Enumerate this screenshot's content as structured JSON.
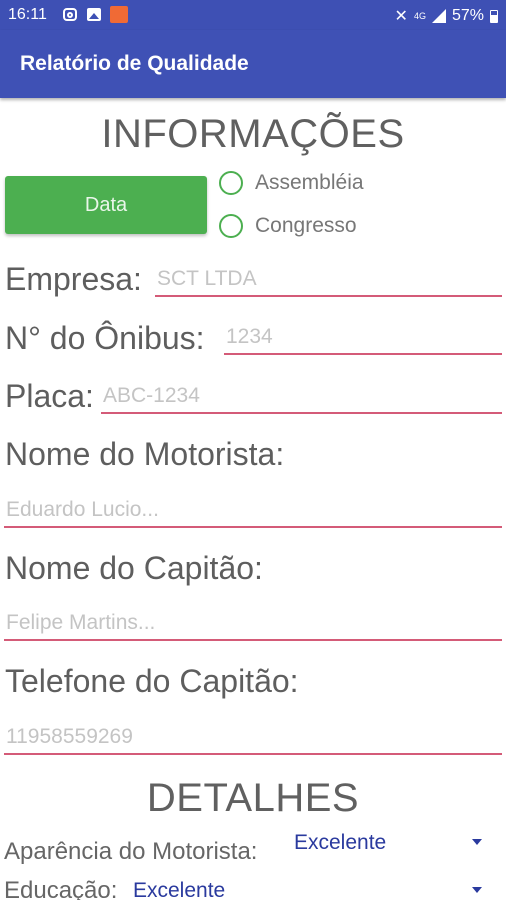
{
  "status_bar": {
    "time": "16:11",
    "signal_label": "4G",
    "battery": "57%",
    "battery_level": 0.57,
    "icons": [
      "instagram-icon",
      "gallery-icon",
      "app-notification-icon",
      "mute-icon",
      "signal-icon",
      "battery-icon"
    ]
  },
  "app_bar": {
    "title": "Relatório de Qualidade"
  },
  "info": {
    "heading": "INFORMAÇÕES",
    "date_button": "Data",
    "radio_options": [
      "Assembléia",
      "Congresso"
    ]
  },
  "fields": {
    "empresa": {
      "label": "Empresa:",
      "placeholder": "SCT LTDA"
    },
    "onibus": {
      "label": "N° do Ônibus:",
      "placeholder": "1234"
    },
    "placa": {
      "label": "Placa:",
      "placeholder": "ABC-1234"
    },
    "motorista": {
      "label": "Nome do Motorista:",
      "placeholder": "Eduardo Lucio..."
    },
    "capitao": {
      "label": "Nome do Capitão:",
      "placeholder": "Felipe Martins..."
    },
    "telefone": {
      "label": "Telefone do Capitão:",
      "placeholder": "11958559269"
    }
  },
  "details": {
    "heading": "DETALHES",
    "aparencia": {
      "label": "Aparência do Motorista:",
      "value": "Excelente"
    },
    "educacao": {
      "label": "Educação:",
      "value": "Excelente"
    }
  },
  "colors": {
    "primary": "#3f51b5",
    "button_green": "#4caf50",
    "underline": "#d45b78",
    "spinner_text": "#2a3a9e"
  }
}
